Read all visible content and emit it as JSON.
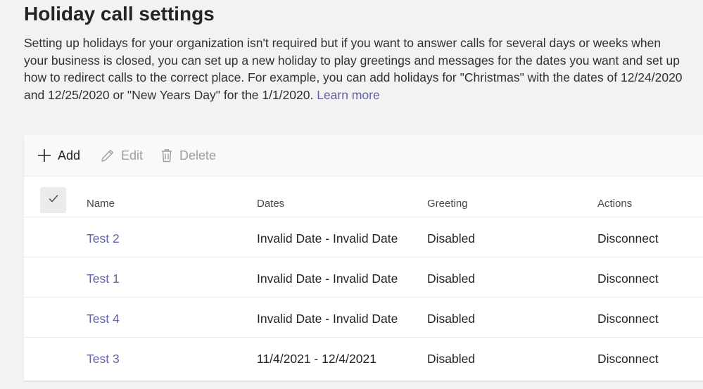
{
  "page": {
    "title": "Holiday call settings",
    "description": "Setting up holidays for your organization isn't required but if you want to answer calls for several days or weeks when your business is closed, you can set up a new holiday to play greetings and messages for the dates you want and set up how to redirect calls to the correct place. For example, you can add holidays for \"Christmas\" with the dates of 12/24/2020 and 12/25/2020 or \"New Years Day\" for the 1/1/2020.",
    "learn_more": "Learn more"
  },
  "toolbar": {
    "add_label": "Add",
    "add_icon": "plus-icon",
    "edit_label": "Edit",
    "edit_icon": "pencil-icon",
    "delete_label": "Delete",
    "delete_icon": "trash-icon"
  },
  "table": {
    "select_all_icon": "checkmark-icon",
    "columns": [
      "Name",
      "Dates",
      "Greeting",
      "Actions"
    ],
    "rows": [
      {
        "name": "Test 2",
        "dates": "Invalid Date - Invalid Date",
        "greeting": "Disabled",
        "actions": "Disconnect"
      },
      {
        "name": "Test 1",
        "dates": "Invalid Date - Invalid Date",
        "greeting": "Disabled",
        "actions": "Disconnect"
      },
      {
        "name": "Test 4",
        "dates": "Invalid Date - Invalid Date",
        "greeting": "Disabled",
        "actions": "Disconnect"
      },
      {
        "name": "Test 3",
        "dates": "11/4/2021 - 12/4/2021",
        "greeting": "Disabled",
        "actions": "Disconnect"
      }
    ]
  },
  "colors": {
    "link": "#6264a7",
    "disabled_text": "#a19f9d",
    "background": "#f3f2f1"
  }
}
